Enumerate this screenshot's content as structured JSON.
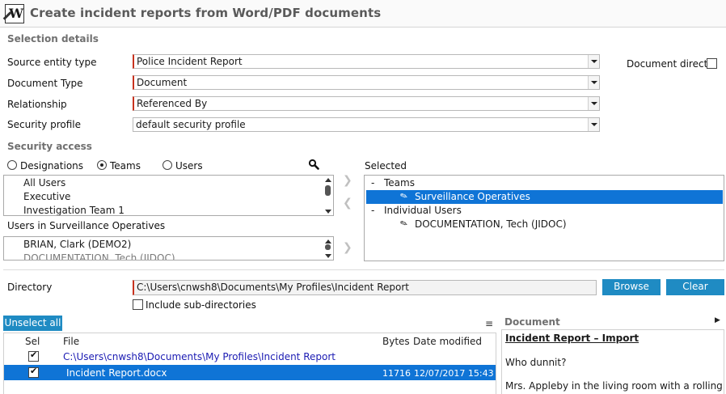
{
  "window": {
    "title": "Create incident reports from Word/PDF documents",
    "icon": "word-document-icon"
  },
  "selection": {
    "heading": "Selection details",
    "source_label": "Source entity type",
    "source_value": "Police Incident Report",
    "doctype_label": "Document Type",
    "doctype_value": "Document",
    "relationship_label": "Relationship",
    "relationship_value": "Referenced By",
    "security_label": "Security profile",
    "security_value": "default security profile",
    "direct_label": "Document direct",
    "direct_checked": false
  },
  "access": {
    "heading": "Security access",
    "radios": [
      "Designations",
      "Teams",
      "Users"
    ],
    "radio_selected": "Teams",
    "teams": [
      "All Users",
      "Executive",
      "Investigation Team 1"
    ],
    "users_label": "Users in Surveillance Operatives",
    "users": [
      "BRIAN, Clark (DEMO2)",
      "DOCUMENTATION, Tech (JIDOC)"
    ],
    "selected_label": "Selected",
    "tree": {
      "teams_group": "Teams",
      "team_item": "Surveillance Operatives",
      "users_group": "Individual Users",
      "user_item": "DOCUMENTATION, Tech (JIDOC)"
    },
    "collapse_glyph": "-"
  },
  "directory": {
    "label": "Directory",
    "value": "C:\\Users\\cnwsh8\\Documents\\My Profiles\\Incident Report",
    "browse": "Browse",
    "clear": "Clear",
    "subdirs_label": "Include sub-directories",
    "subdirs_checked": false
  },
  "files": {
    "unselect_all": "Unselect all",
    "col_sel": "Sel",
    "col_file": "File",
    "col_bytes": "Bytes",
    "col_date": "Date modified",
    "rows": [
      {
        "checked": true,
        "file": "C:\\Users\\cnwsh8\\Documents\\My Profiles\\Incident Report",
        "bytes": "",
        "date": ""
      },
      {
        "checked": true,
        "file": "Incident Report.docx",
        "bytes": "11716",
        "date": "12/07/2017 15:43"
      }
    ]
  },
  "preview": {
    "heading": "Document",
    "doc_title": "Incident Report – Import",
    "line1": "Who dunnit?",
    "line2": "Mrs. Appleby in the living room with a rolling pin"
  },
  "colors": {
    "accent": "#1f8bc3",
    "selection": "#0f74d6",
    "required": "#c8321e",
    "link": "#1b1bb3"
  }
}
